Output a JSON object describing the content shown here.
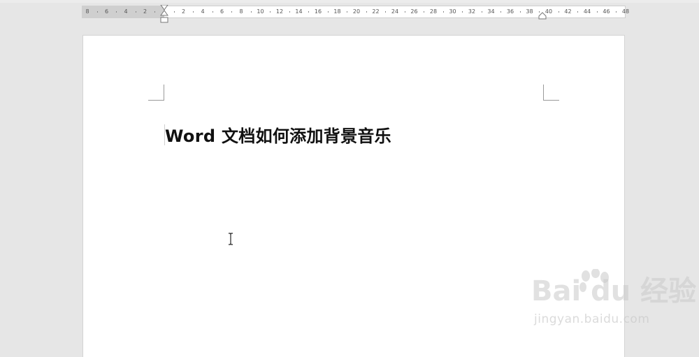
{
  "ruler": {
    "left_labels": [
      "8",
      "6",
      "4",
      "2"
    ],
    "right_labels": [
      "2",
      "4",
      "6",
      "8",
      "10",
      "12",
      "14",
      "16",
      "18",
      "20",
      "22",
      "24",
      "26",
      "28",
      "30",
      "32",
      "34",
      "36",
      "38",
      "40",
      "42",
      "44",
      "46",
      "48"
    ]
  },
  "document": {
    "heading": "Word 文档如何添加背景音乐"
  },
  "watermark": {
    "logo_text": "Bai du 经验",
    "url_text": "jingyan.baidu.com"
  },
  "colors": {
    "workspace": "#e6e6e6",
    "page": "#ffffff",
    "ruler_gray": "#cfcfcf",
    "text": "#111111"
  }
}
